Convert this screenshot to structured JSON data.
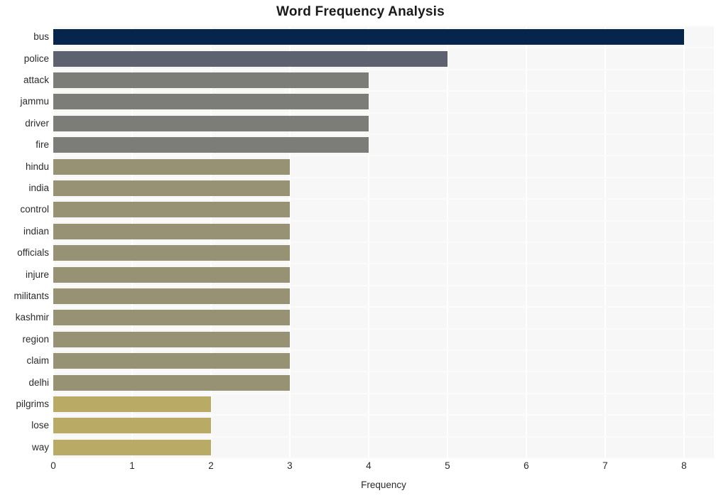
{
  "chart_data": {
    "type": "bar",
    "orientation": "horizontal",
    "title": "Word Frequency Analysis",
    "xlabel": "Frequency",
    "ylabel": "",
    "categories": [
      "bus",
      "police",
      "attack",
      "jammu",
      "driver",
      "fire",
      "hindu",
      "india",
      "control",
      "indian",
      "officials",
      "injure",
      "militants",
      "kashmir",
      "region",
      "claim",
      "delhi",
      "pilgrims",
      "lose",
      "way"
    ],
    "values": [
      8,
      5,
      4,
      4,
      4,
      4,
      3,
      3,
      3,
      3,
      3,
      3,
      3,
      3,
      3,
      3,
      3,
      2,
      2,
      2
    ],
    "bar_colors": [
      "#06254d",
      "#5e6270",
      "#7c7c79",
      "#7c7c79",
      "#7c7c79",
      "#7c7c79",
      "#989274",
      "#989274",
      "#989274",
      "#989274",
      "#989274",
      "#989274",
      "#989274",
      "#989274",
      "#989274",
      "#989274",
      "#989274",
      "#b9ab66",
      "#b9ab66",
      "#b9ab66"
    ],
    "xticks": [
      0,
      1,
      2,
      3,
      4,
      5,
      6,
      7,
      8
    ],
    "xtick_labels": [
      "0",
      "1",
      "2",
      "3",
      "4",
      "5",
      "6",
      "7",
      "8"
    ],
    "xlim": [
      0,
      8.38
    ],
    "grid": true,
    "grid_color": "#ffffff",
    "legend": "none",
    "plot_background": "#f7f7f7",
    "figure_background": "#ffffff"
  }
}
